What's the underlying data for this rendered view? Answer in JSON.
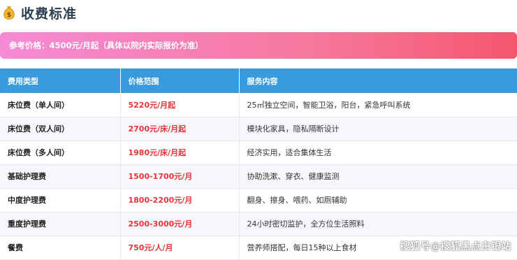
{
  "header": {
    "icon": "money-bag-icon",
    "title": "收费标准"
  },
  "banner": {
    "text": "参考价格：4500元/月起（具体以院内实际报价为准）"
  },
  "table": {
    "columns": [
      "费用类型",
      "价格范围",
      "服务内容"
    ],
    "rows": [
      {
        "type": "床位费（单人间）",
        "price": "5220元/月起",
        "service": "25㎡独立空间，智能卫浴，阳台，紧急呼叫系统"
      },
      {
        "type": "床位费（双人间）",
        "price": "2700元/床/月起",
        "service": "模块化家具，隐私隔断设计"
      },
      {
        "type": "床位费（多人间）",
        "price": "1980元/床/月起",
        "service": "经济实用，适合集体生活"
      },
      {
        "type": "基础护理费",
        "price": "1500-1700元/月",
        "service": "协助洗漱、穿衣、健康监测"
      },
      {
        "type": "中度护理费",
        "price": "1800-2200元/月",
        "service": "翻身、擦身、喂药、如厕辅助"
      },
      {
        "type": "重度护理费",
        "price": "2500-3000元/月",
        "service": "24小时密切监护，全方位生活照料"
      },
      {
        "type": "餐费",
        "price": "750元/人/月",
        "service": "营养师搭配，每日15种以上食材"
      }
    ]
  },
  "watermark": {
    "text": "搜狐号@搜狐黑点白银站"
  },
  "colors": {
    "header_bg": "#3a9bdc",
    "price_text": "#e8343a",
    "banner_gradient_start": "#f68ad6",
    "banner_gradient_end": "#f5566d"
  }
}
